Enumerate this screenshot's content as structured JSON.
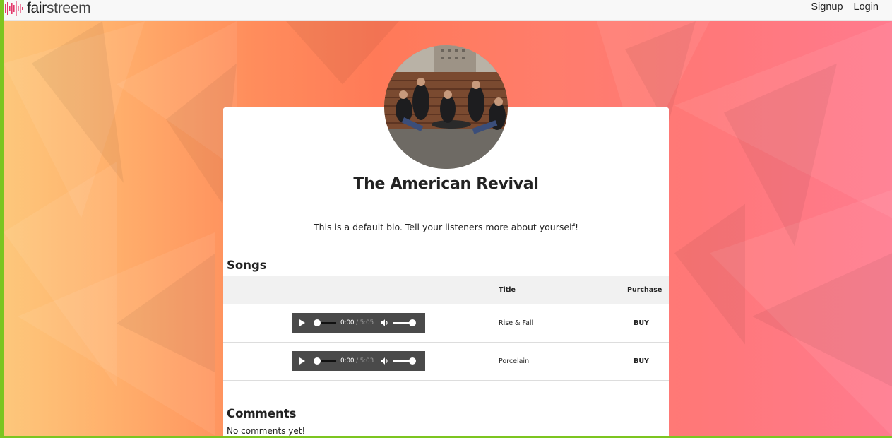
{
  "brand": {
    "part1": "fair",
    "part2": "streem"
  },
  "nav": {
    "signup": "Signup",
    "login": "Login"
  },
  "artist": {
    "name": "The American Revival",
    "bio": "This is a default bio. Tell your listeners more about yourself!"
  },
  "songs": {
    "heading": "Songs",
    "columns": {
      "player": "",
      "title": "Title",
      "purchase": "Purchase"
    },
    "rows": [
      {
        "title": "Rise & Fall",
        "current": "0:00",
        "separator": "/",
        "duration": "5:05",
        "buy": "BUY"
      },
      {
        "title": "Porcelain",
        "current": "0:00",
        "separator": "/",
        "duration": "5:03",
        "buy": "BUY"
      }
    ]
  },
  "comments": {
    "heading": "Comments",
    "empty": "No comments yet!"
  },
  "colors": {
    "frame_border": "#7cc520",
    "gradient_left": "#fdc77b",
    "gradient_mid": "#ff7a58",
    "gradient_right": "#ff7a8e",
    "player_bg": "#4a4a4a",
    "logo_accent": "#e3386b"
  },
  "icons": [
    "logo-waveform-icon",
    "play-icon",
    "volume-icon"
  ]
}
